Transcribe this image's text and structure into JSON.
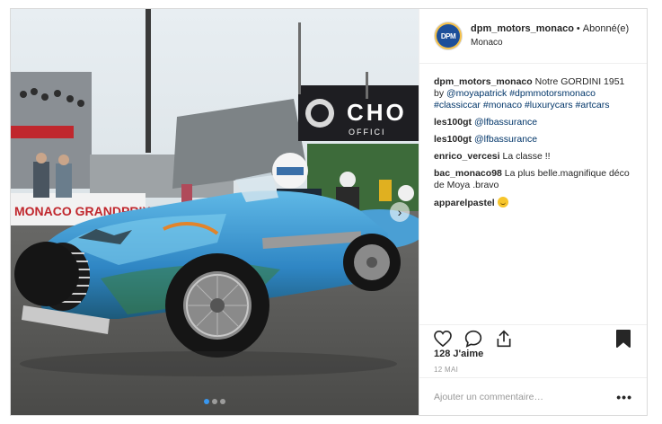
{
  "post": {
    "author": "dpm_motors_monaco",
    "separator": "•",
    "follow_status": "Abonné(e)",
    "location": "Monaco",
    "avatar_text": "DPM"
  },
  "image": {
    "alt": "Gordini 1951 classic race car at Monaco",
    "banner_text": "MONACO GRANDPRIX",
    "banner2_text": "CHO",
    "banner2_sub": "OFFICI",
    "carousel_count": 3,
    "carousel_active": 0,
    "next_icon": "chevron-right-icon"
  },
  "caption": {
    "user": "dpm_motors_monaco",
    "text_before": " Notre GORDINI 1951 by ",
    "mention": "@moyapatrick",
    "hashtags": " #dpmmotorsmonaco #classiccar #monaco #luxurycars #artcars"
  },
  "comments": [
    {
      "user": "les100gt",
      "mention": "@lfbassurance",
      "text": ""
    },
    {
      "user": "les100gt",
      "mention": "@lfbassurance",
      "text": ""
    },
    {
      "user": "enrico_vercesi",
      "mention": "",
      "text": "La classe !!"
    },
    {
      "user": "bac_monaco98",
      "mention": "",
      "text": "La plus belle.magnifique déco de Moya .bravo"
    },
    {
      "user": "apparelpastel",
      "mention": "",
      "text": ""
    }
  ],
  "actions": {
    "like_icon": "heart-icon",
    "comment_icon": "comment-bubble-icon",
    "share_icon": "share-icon",
    "save_icon": "bookmark-icon"
  },
  "likes": "128 J'aime",
  "date": "12 MAI",
  "add_comment": {
    "placeholder": "Ajouter un commentaire…",
    "more_label": "•••"
  },
  "colors": {
    "link": "#003569",
    "text": "#262626",
    "muted": "#999999",
    "border": "#dbdbdb",
    "carousel_active": "#3897f0"
  }
}
